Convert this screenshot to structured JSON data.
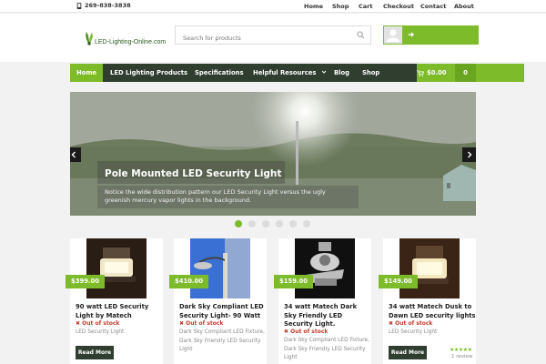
{
  "topbar": {
    "phone": "269-838-3838",
    "links": [
      "Home",
      "Shop",
      "Cart",
      "Checkout",
      "Contact",
      "About"
    ]
  },
  "header": {
    "logo_text": "LED-Lighting-Online.com",
    "search_placeholder": "Search for products"
  },
  "nav": {
    "items": [
      "Home",
      "LED Lighting Products",
      "Specifications",
      "Helpful Resources",
      "Blog",
      "Shop"
    ],
    "cart_total": "$0.00",
    "cart_count": "0"
  },
  "slider": {
    "title": "Pole Mounted LED Security Light",
    "description": "Notice the wide distribution pattern our LED Security Light versus the ugly greenish mercury vapor lights in the background.",
    "slide_count": 6,
    "active_slide": 1
  },
  "products": [
    {
      "price": "$399.00",
      "title": "90 watt LED Security Light by Matech",
      "stock": "Out of stock",
      "categories": "LED Security Light",
      "button": "Read More"
    },
    {
      "price": "$410.00",
      "title": "Dark Sky Compliant LED Security Light- 90 Watt",
      "stock": "Out of stock",
      "categories": "Dark Sky Compliant LED Fixture, Dark Sky Friendly LED Security Light",
      "button": ""
    },
    {
      "price": "$159.00",
      "title": "34 watt Matech Dark Sky Friendly LED Security Light.",
      "stock": "Out of stock",
      "categories": "Dark Sky Compliant LED Fixture, Dark Sky Friendly LED Security Light",
      "button": ""
    },
    {
      "price": "$149.00",
      "title": "34 watt Matech Dusk to Dawn LED security lights",
      "stock": "Out of stock",
      "categories": "LED Security Light",
      "button": "Read More",
      "rating": 5,
      "reviews": "1 review"
    }
  ],
  "colors": {
    "accent": "#7dbb2a",
    "nav_dark": "#2f3e2f",
    "out_of_stock": "#c0392b"
  }
}
